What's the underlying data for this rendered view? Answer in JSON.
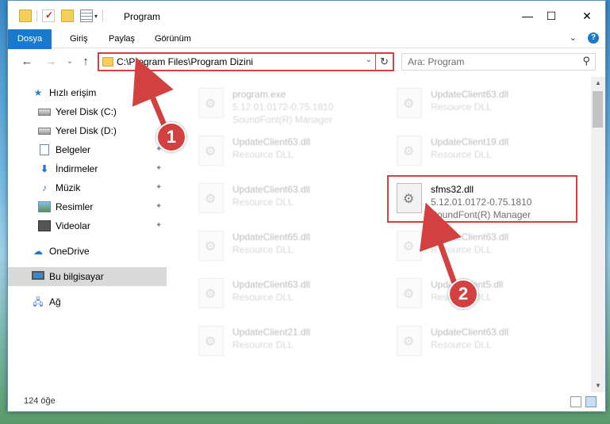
{
  "window": {
    "title": "Program",
    "controls": {
      "minimize": "—",
      "maximize": "☐",
      "close": "✕"
    }
  },
  "ribbon": {
    "tabs": [
      "Dosya",
      "Giriş",
      "Paylaş",
      "Görünüm"
    ],
    "expand_glyph": "⌄",
    "help_glyph": "?"
  },
  "nav": {
    "back_glyph": "←",
    "forward_glyph": "→",
    "recent_glyph": "⌄",
    "up_glyph": "↑",
    "address": "C:\\Program Files\\Program Dizini",
    "search_placeholder": "Ara: Program",
    "address_drop_glyph": "⌄",
    "refresh_glyph": "↻",
    "search_glyph": "⚲"
  },
  "sidebar": {
    "items": [
      {
        "label": "Hızlı erişim",
        "icon": "star-icon"
      },
      {
        "label": "Yerel Disk (C:)",
        "icon": "drive-icon"
      },
      {
        "label": "Yerel Disk (D:)",
        "icon": "drive-icon"
      },
      {
        "label": "Belgeler",
        "icon": "documents-icon"
      },
      {
        "label": "İndirmeler",
        "icon": "downloads-icon"
      },
      {
        "label": "Müzik",
        "icon": "music-icon"
      },
      {
        "label": "Resimler",
        "icon": "pictures-icon"
      },
      {
        "label": "Videolar",
        "icon": "videos-icon"
      },
      {
        "label": "OneDrive",
        "icon": "onedrive-icon"
      },
      {
        "label": "Bu bilgisayar",
        "icon": "this-pc-icon"
      },
      {
        "label": "Ağ",
        "icon": "network-icon"
      }
    ],
    "pin_glyph": "📌"
  },
  "files": [
    {
      "name": "program.exe",
      "line2": "5.12.01.0172-0.75.1810",
      "line3": "SoundFont(R) Manager"
    },
    {
      "name": "UpdateClient63.dll",
      "line2": "Resource DLL",
      "line3": ""
    },
    {
      "name": "UpdateClient63.dll",
      "line2": "Resource DLL",
      "line3": ""
    },
    {
      "name": "UpdateClient19.dll",
      "line2": "Resource DLL",
      "line3": ""
    },
    {
      "name": "UpdateClient63.dll",
      "line2": "Resource DLL",
      "line3": ""
    },
    {
      "name": "sfms32.dll",
      "line2": "5.12.01.0172-0.75.1810",
      "line3": "SoundFont(R) Manager"
    },
    {
      "name": "UpdateClient65.dll",
      "line2": "Resource DLL",
      "line3": ""
    },
    {
      "name": "UpdateClient63.dll",
      "line2": "Resource DLL",
      "line3": ""
    },
    {
      "name": "UpdateClient63.dll",
      "line2": "Resource DLL",
      "line3": ""
    },
    {
      "name": "UpdateClient5.dll",
      "line2": "Resource DLL",
      "line3": ""
    },
    {
      "name": "UpdateClient21.dll",
      "line2": "Resource DLL",
      "line3": ""
    },
    {
      "name": "UpdateClient63.dll",
      "line2": "Resource DLL",
      "line3": ""
    }
  ],
  "status": {
    "count": "124 öğe"
  },
  "callouts": [
    "1",
    "2"
  ],
  "colors": {
    "accent": "#1979ca",
    "highlight": "#d24040"
  }
}
